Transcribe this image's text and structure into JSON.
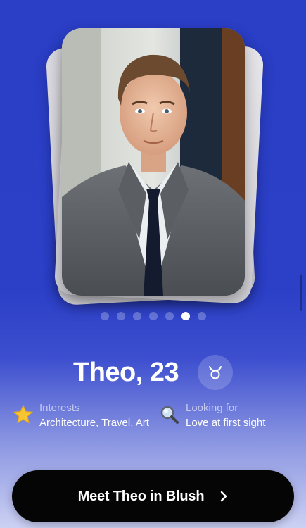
{
  "profile": {
    "name_age": "Theo, 23",
    "zodiac_symbol": "♉",
    "zodiac_icon": "taurus-icon"
  },
  "photo_pager": {
    "count": 7,
    "active_index": 5
  },
  "info": {
    "interests": {
      "icon": "star-icon",
      "label": "Interests",
      "value": "Architecture, Travel, Art"
    },
    "looking_for": {
      "icon": "magnifier-icon",
      "label": "Looking for",
      "value": "Love at first sight"
    }
  },
  "cta": {
    "label": "Meet Theo in Blush",
    "icon": "chevron-right-icon"
  },
  "colors": {
    "background_top": "#2a3ec6",
    "background_bottom": "#ccd1f3",
    "button": "#050505",
    "star": "#f7c531"
  }
}
